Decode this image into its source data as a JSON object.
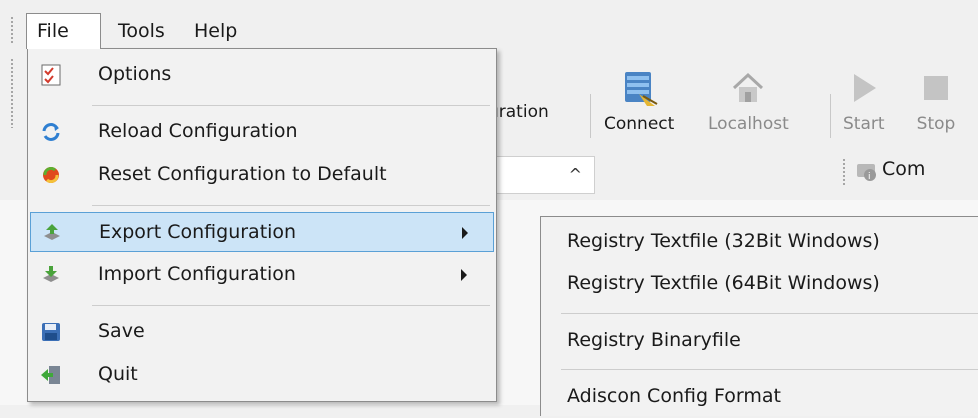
{
  "menubar": {
    "file": "File",
    "tools": "Tools",
    "help": "Help"
  },
  "toolbar": {
    "configuration_partial": "uration",
    "connect": "Connect",
    "localhost": "Localhost",
    "start": "Start",
    "stop": "Stop"
  },
  "address_bar": {
    "value": "",
    "secondary_label_partial": "Com"
  },
  "file_menu": {
    "items": [
      {
        "label": "Options",
        "icon": "checklist-icon"
      },
      {
        "label": "Reload Configuration",
        "icon": "refresh-icon"
      },
      {
        "label": "Reset Configuration to Default",
        "icon": "reset-icon"
      },
      {
        "label": "Export Configuration",
        "icon": "export-icon",
        "has_submenu": true,
        "highlighted": true
      },
      {
        "label": "Import Configuration",
        "icon": "import-icon",
        "has_submenu": true
      },
      {
        "label": "Save",
        "icon": "floppy-disk-icon"
      },
      {
        "label": "Quit",
        "icon": "exit-icon"
      }
    ]
  },
  "export_submenu": {
    "items": [
      {
        "label": "Registry Textfile (32Bit Windows)"
      },
      {
        "label": "Registry Textfile (64Bit Windows)"
      },
      {
        "label": "Registry Binaryfile"
      },
      {
        "label": "Adiscon Config Format"
      }
    ]
  },
  "colors": {
    "highlight_bg": "#cce4f7",
    "highlight_border": "#5aa0d6",
    "menu_bg": "#f2f2f2",
    "window_bg": "#f0f0f0"
  }
}
